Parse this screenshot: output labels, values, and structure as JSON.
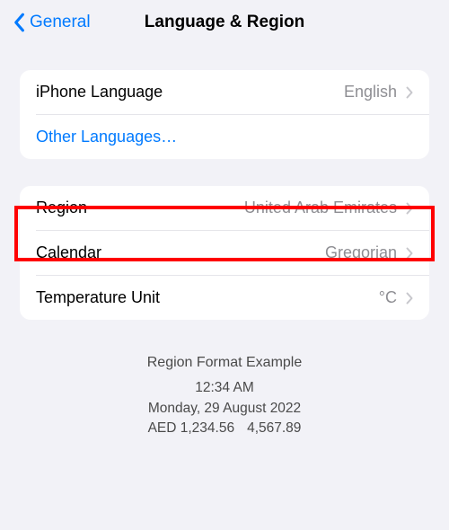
{
  "header": {
    "back_label": "General",
    "title": "Language & Region"
  },
  "group1": {
    "language": {
      "label": "iPhone Language",
      "value": "English"
    },
    "other_languages": {
      "label": "Other Languages…"
    }
  },
  "group2": {
    "region": {
      "label": "Region",
      "value": "United Arab Emirates"
    },
    "calendar": {
      "label": "Calendar",
      "value": "Gregorian"
    },
    "temperature": {
      "label": "Temperature Unit",
      "value": "°C"
    }
  },
  "footer": {
    "title": "Region Format Example",
    "time": "12:34 AM",
    "date": "Monday, 29 August 2022",
    "currency": "AED 1,234.56",
    "number": "4,567.89"
  }
}
